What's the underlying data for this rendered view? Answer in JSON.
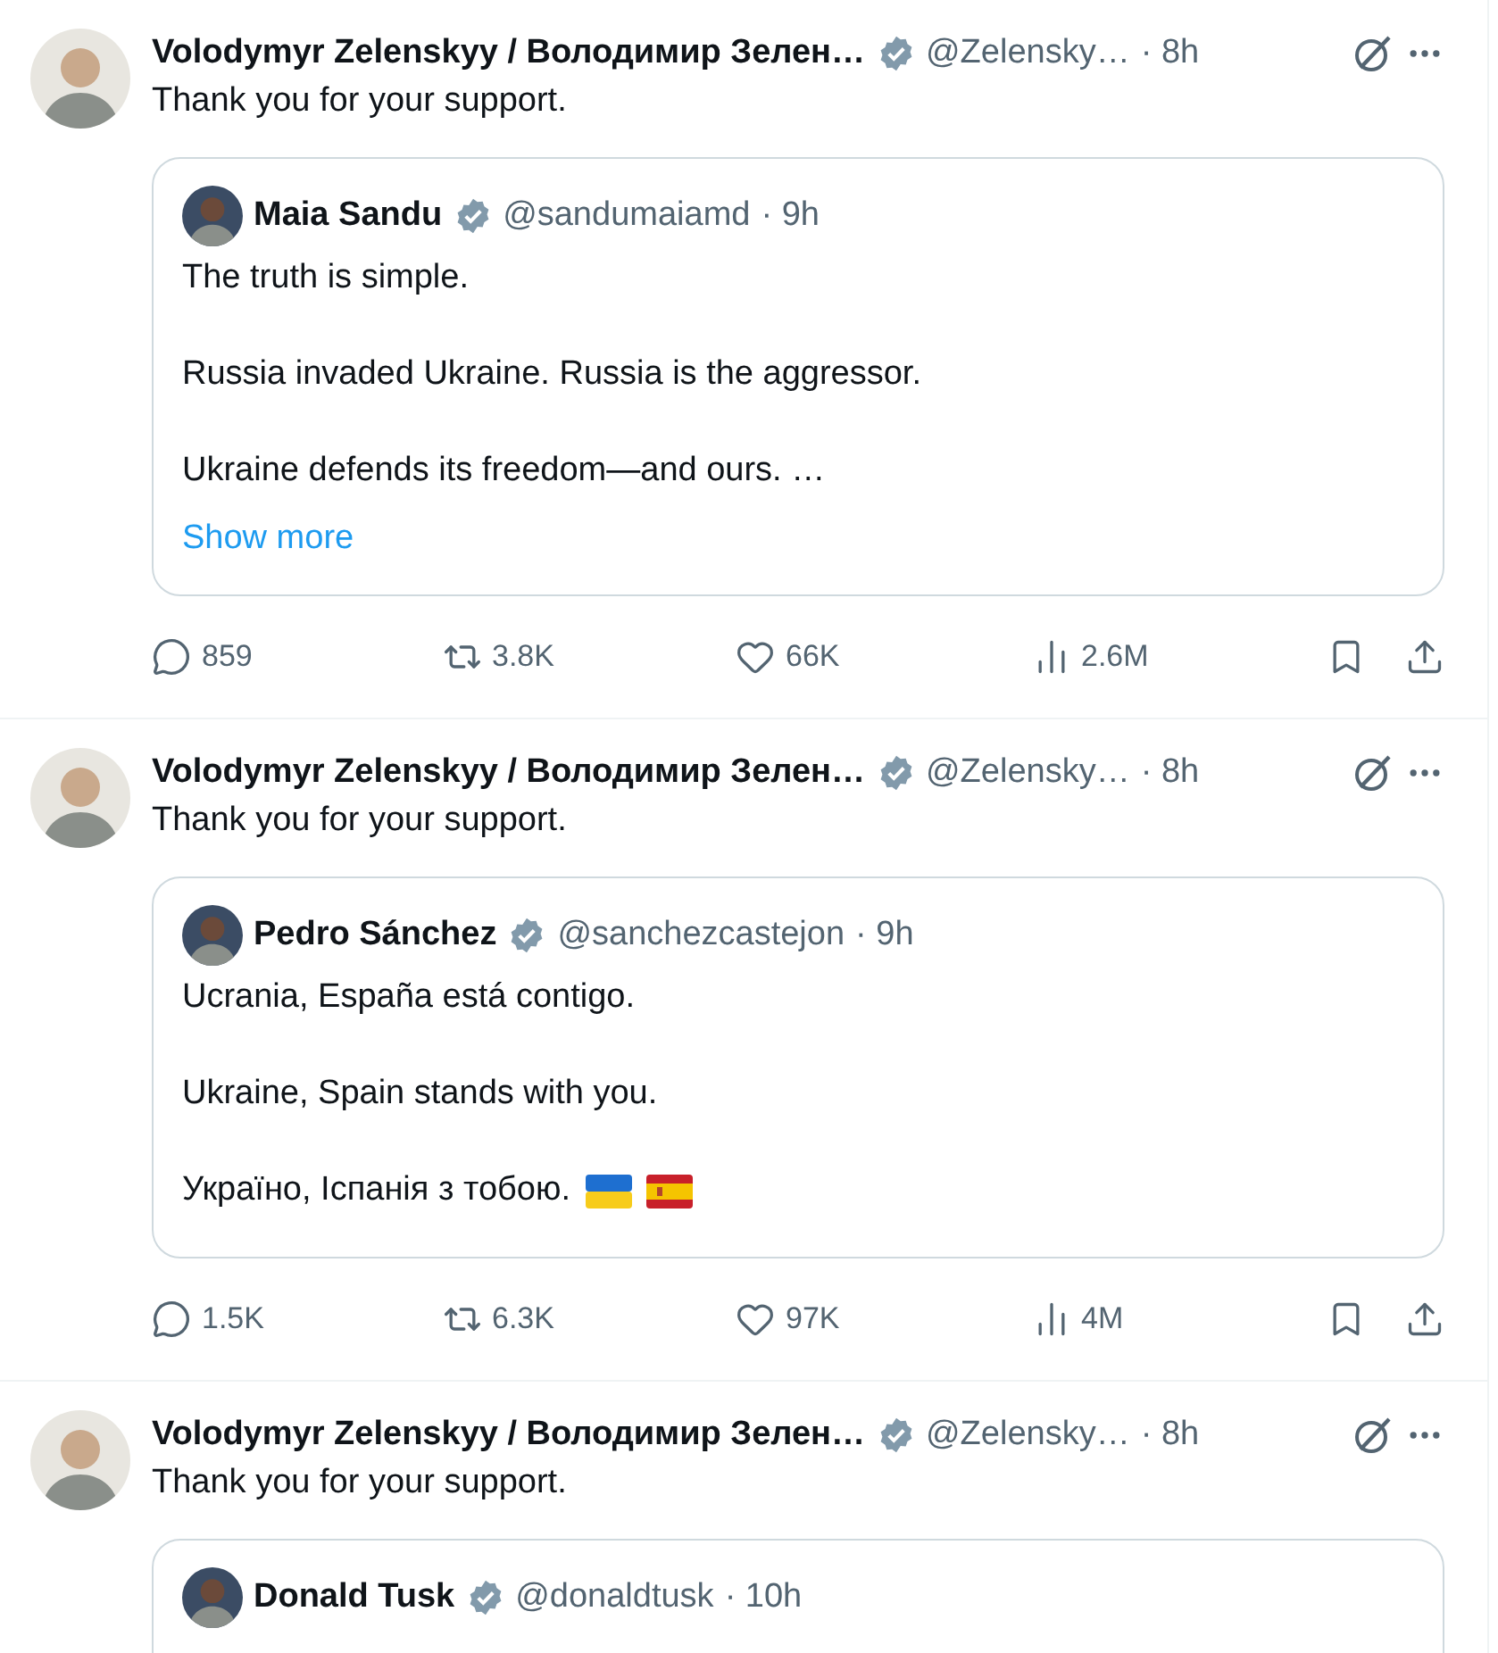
{
  "tweets": [
    {
      "author": {
        "name": "Volodymyr Zelenskyy / Володимир Зелен…",
        "handle": "@Zelensky…",
        "time": "· 8h"
      },
      "text": "Thank you for your support.",
      "quote": {
        "author": {
          "name": "Maia Sandu",
          "handle": "@sandumaiamd",
          "time": "· 9h"
        },
        "paragraphs": [
          "The truth is simple.",
          "Russia invaded Ukraine. Russia is the aggressor.",
          "Ukraine defends its freedom—and ours. …"
        ],
        "show_more": "Show more"
      },
      "stats": {
        "replies": "859",
        "reposts": "3.8K",
        "likes": "66K",
        "views": "2.6M"
      }
    },
    {
      "author": {
        "name": "Volodymyr Zelenskyy / Володимир Зелен…",
        "handle": "@Zelensky…",
        "time": "· 8h"
      },
      "text": "Thank you for your support.",
      "quote": {
        "author": {
          "name": "Pedro Sánchez",
          "handle": "@sanchezcastejon",
          "time": "· 9h"
        },
        "paragraphs": [
          "Ucrania, España está contigo.",
          "Ukraine, Spain stands with you.",
          "Україно, Іспанія з тобою."
        ],
        "flags": [
          {
            "kind": "ukraine"
          },
          {
            "kind": "spain"
          }
        ]
      },
      "stats": {
        "replies": "1.5K",
        "reposts": "6.3K",
        "likes": "97K",
        "views": "4M"
      }
    },
    {
      "author": {
        "name": "Volodymyr Zelenskyy / Володимир Зелен…",
        "handle": "@Zelensky…",
        "time": "· 8h"
      },
      "text": "Thank you for your support.",
      "quote": {
        "author": {
          "name": "Donald Tusk",
          "handle": "@donaldtusk",
          "time": "· 10h"
        }
      }
    }
  ]
}
